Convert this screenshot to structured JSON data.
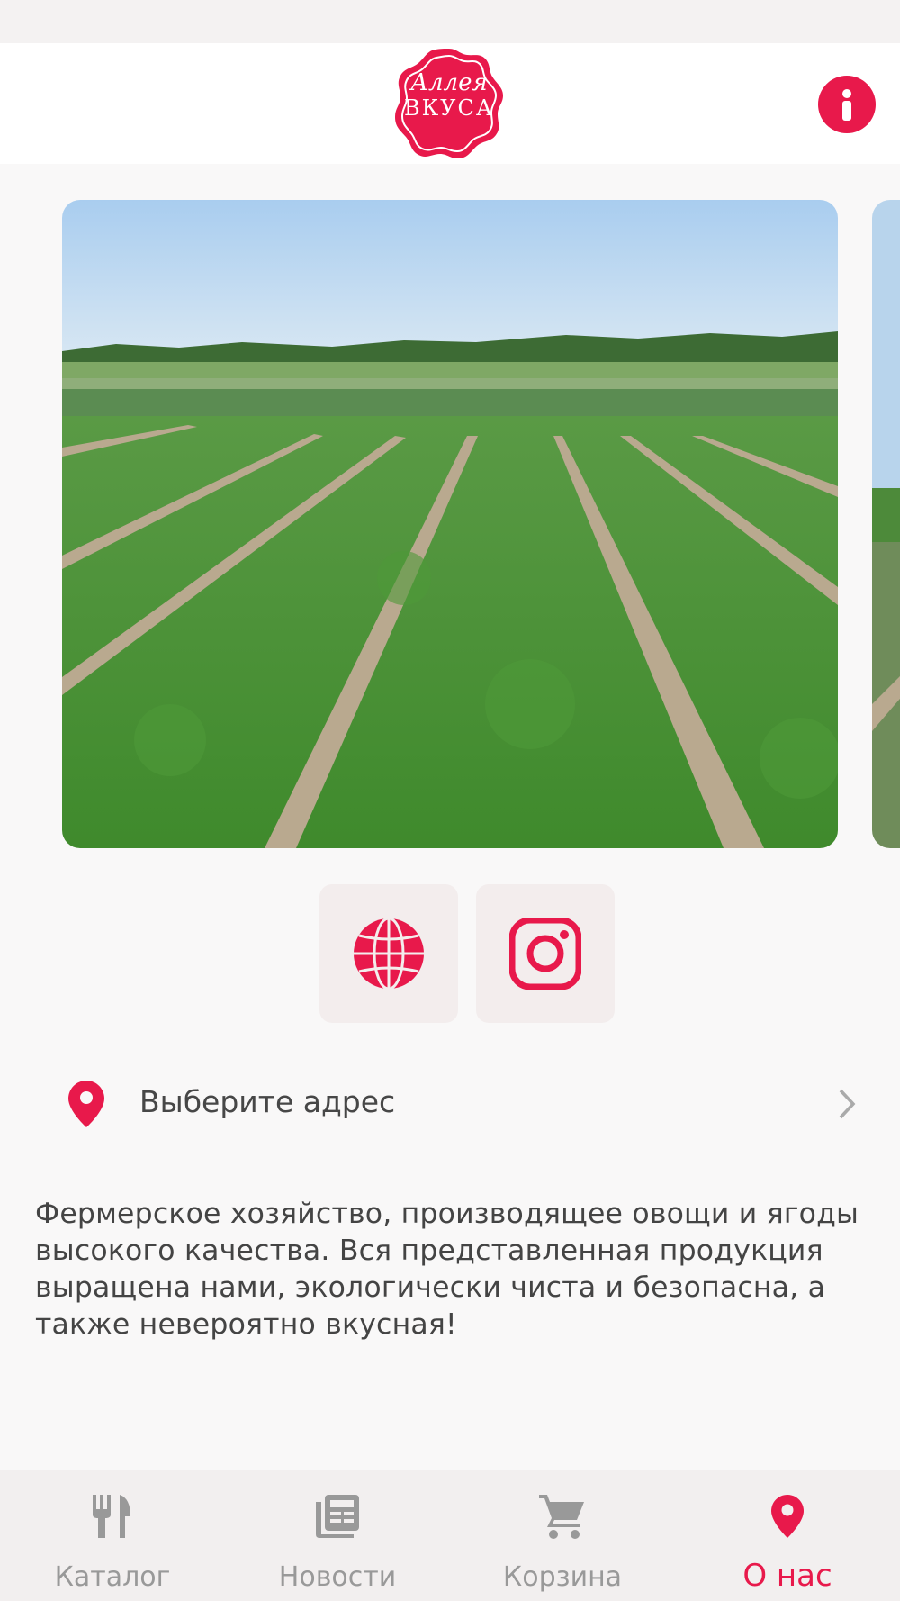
{
  "header": {
    "logo_line1": "Аллея",
    "logo_line2": "ВКУСА",
    "info_icon": "info-icon"
  },
  "colors": {
    "accent": "#e8194b",
    "background": "#f9f8f8",
    "tabbar": "#f2efef",
    "inactive": "#999999"
  },
  "social": [
    {
      "icon": "globe-icon"
    },
    {
      "icon": "instagram-icon"
    }
  ],
  "address": {
    "icon": "map-pin-icon",
    "label": "Выберите адрес",
    "chevron": "chevron-right-icon"
  },
  "description": "Фермерское хозяйство, производящее овощи и ягоды высокого качества. Вся представленная продукция выращена нами, экологически чиста и безопасна, а также невероятно вкусная!",
  "tabs": [
    {
      "label": "Каталог",
      "icon": "fork-knife-icon",
      "active": false
    },
    {
      "label": "Новости",
      "icon": "news-icon",
      "active": false
    },
    {
      "label": "Корзина",
      "icon": "cart-icon",
      "active": false
    },
    {
      "label": "О нас",
      "icon": "map-pin-icon",
      "active": true
    }
  ]
}
